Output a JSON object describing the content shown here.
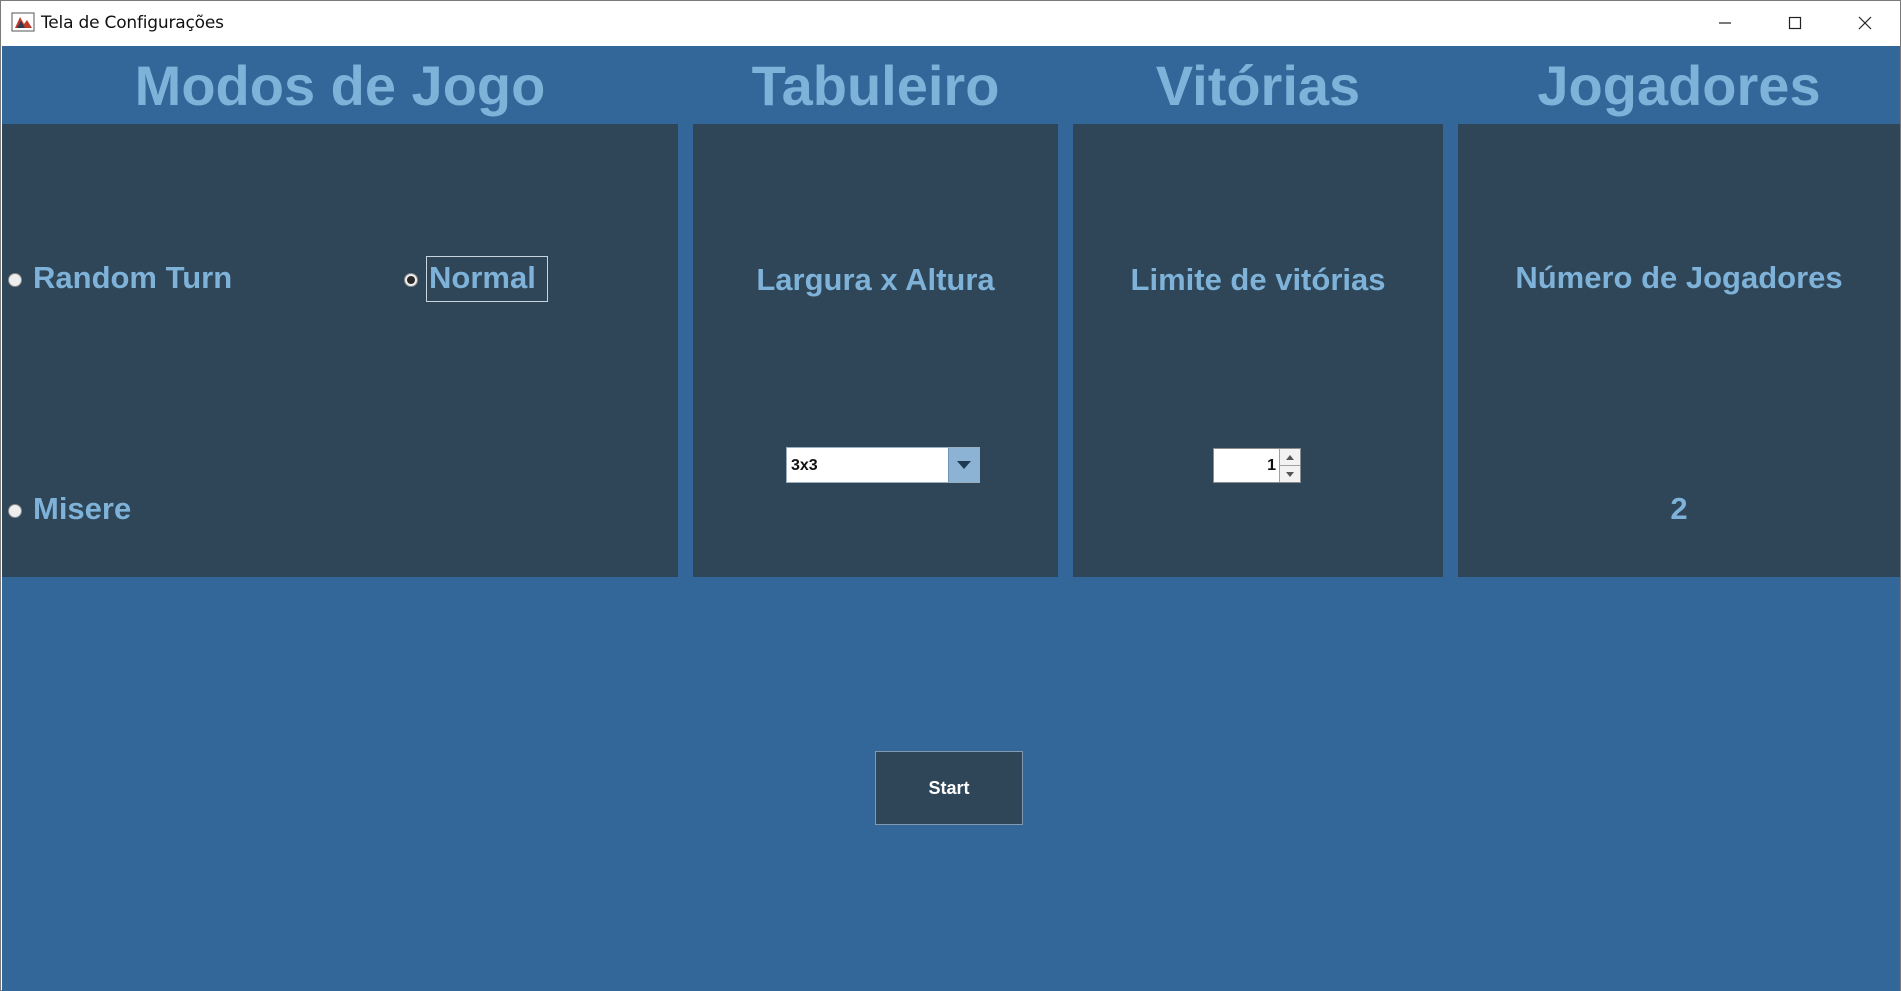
{
  "window": {
    "title": "Tela de Configurações"
  },
  "headers": {
    "modes": "Modos de Jogo",
    "board": "Tabuleiro",
    "victories": "Vitórias",
    "players": "Jogadores"
  },
  "modes": {
    "options": [
      {
        "label": "Random Turn",
        "selected": false
      },
      {
        "label": "Normal",
        "selected": true
      },
      {
        "label": "Misere",
        "selected": false
      }
    ]
  },
  "board": {
    "label": "Largura x Altura",
    "selected_size": "3x3"
  },
  "victories": {
    "label": "Limite de vitórias",
    "limit_value": "1"
  },
  "players": {
    "label": "Número de Jogadores",
    "count": "2"
  },
  "actions": {
    "start_label": "Start"
  },
  "colors": {
    "background": "#336699",
    "panel": "#2e4658",
    "label": "#7fb2d8"
  }
}
